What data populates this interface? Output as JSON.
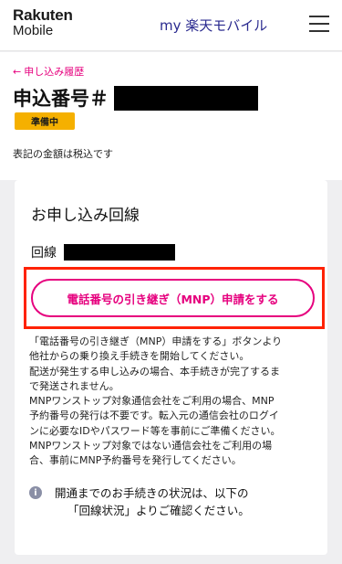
{
  "header": {
    "logo_line1": "Rakuten",
    "logo_line2": "Mobile",
    "title": "my 楽天モバイル",
    "menu_icon": "hamburger-menu-icon"
  },
  "page": {
    "back_link": "申し込み履歴",
    "application_number_label": "申込番号＃",
    "status_badge": "準備中",
    "tax_note": "表記の金額は税込です"
  },
  "card": {
    "title": "お申し込み回線",
    "line_label": "回線",
    "mnp_button_label": "電話番号の引き継ぎ（MNP）申請をする",
    "description_lines": [
      "「電話番号の引き継ぎ（MNP）申請をする」ボタンより",
      "他社からの乗り換え手続きを開始してください。",
      "配送が発生する申し込みの場合、本手続きが完了するま",
      "で発送されません。",
      "MNPワンストップ対象通信会社をご利用の場合、MNP",
      "予約番号の発行は不要です。転入元の通信会社のログイ",
      "ンに必要なIDやパスワード等を事前にご準備ください。",
      "MNPワンストップ対象ではない通信会社をご利用の場",
      "合、事前にMNP予約番号を発行してください。"
    ],
    "info_line1": "開通までのお手続きの状況は、以下の",
    "info_line2": "「回線状況」よりご確認ください。"
  },
  "colors": {
    "accent": "#e6007e",
    "badge": "#f5b000",
    "highlight": "#ff2200",
    "header_title": "#2a2a8f"
  }
}
